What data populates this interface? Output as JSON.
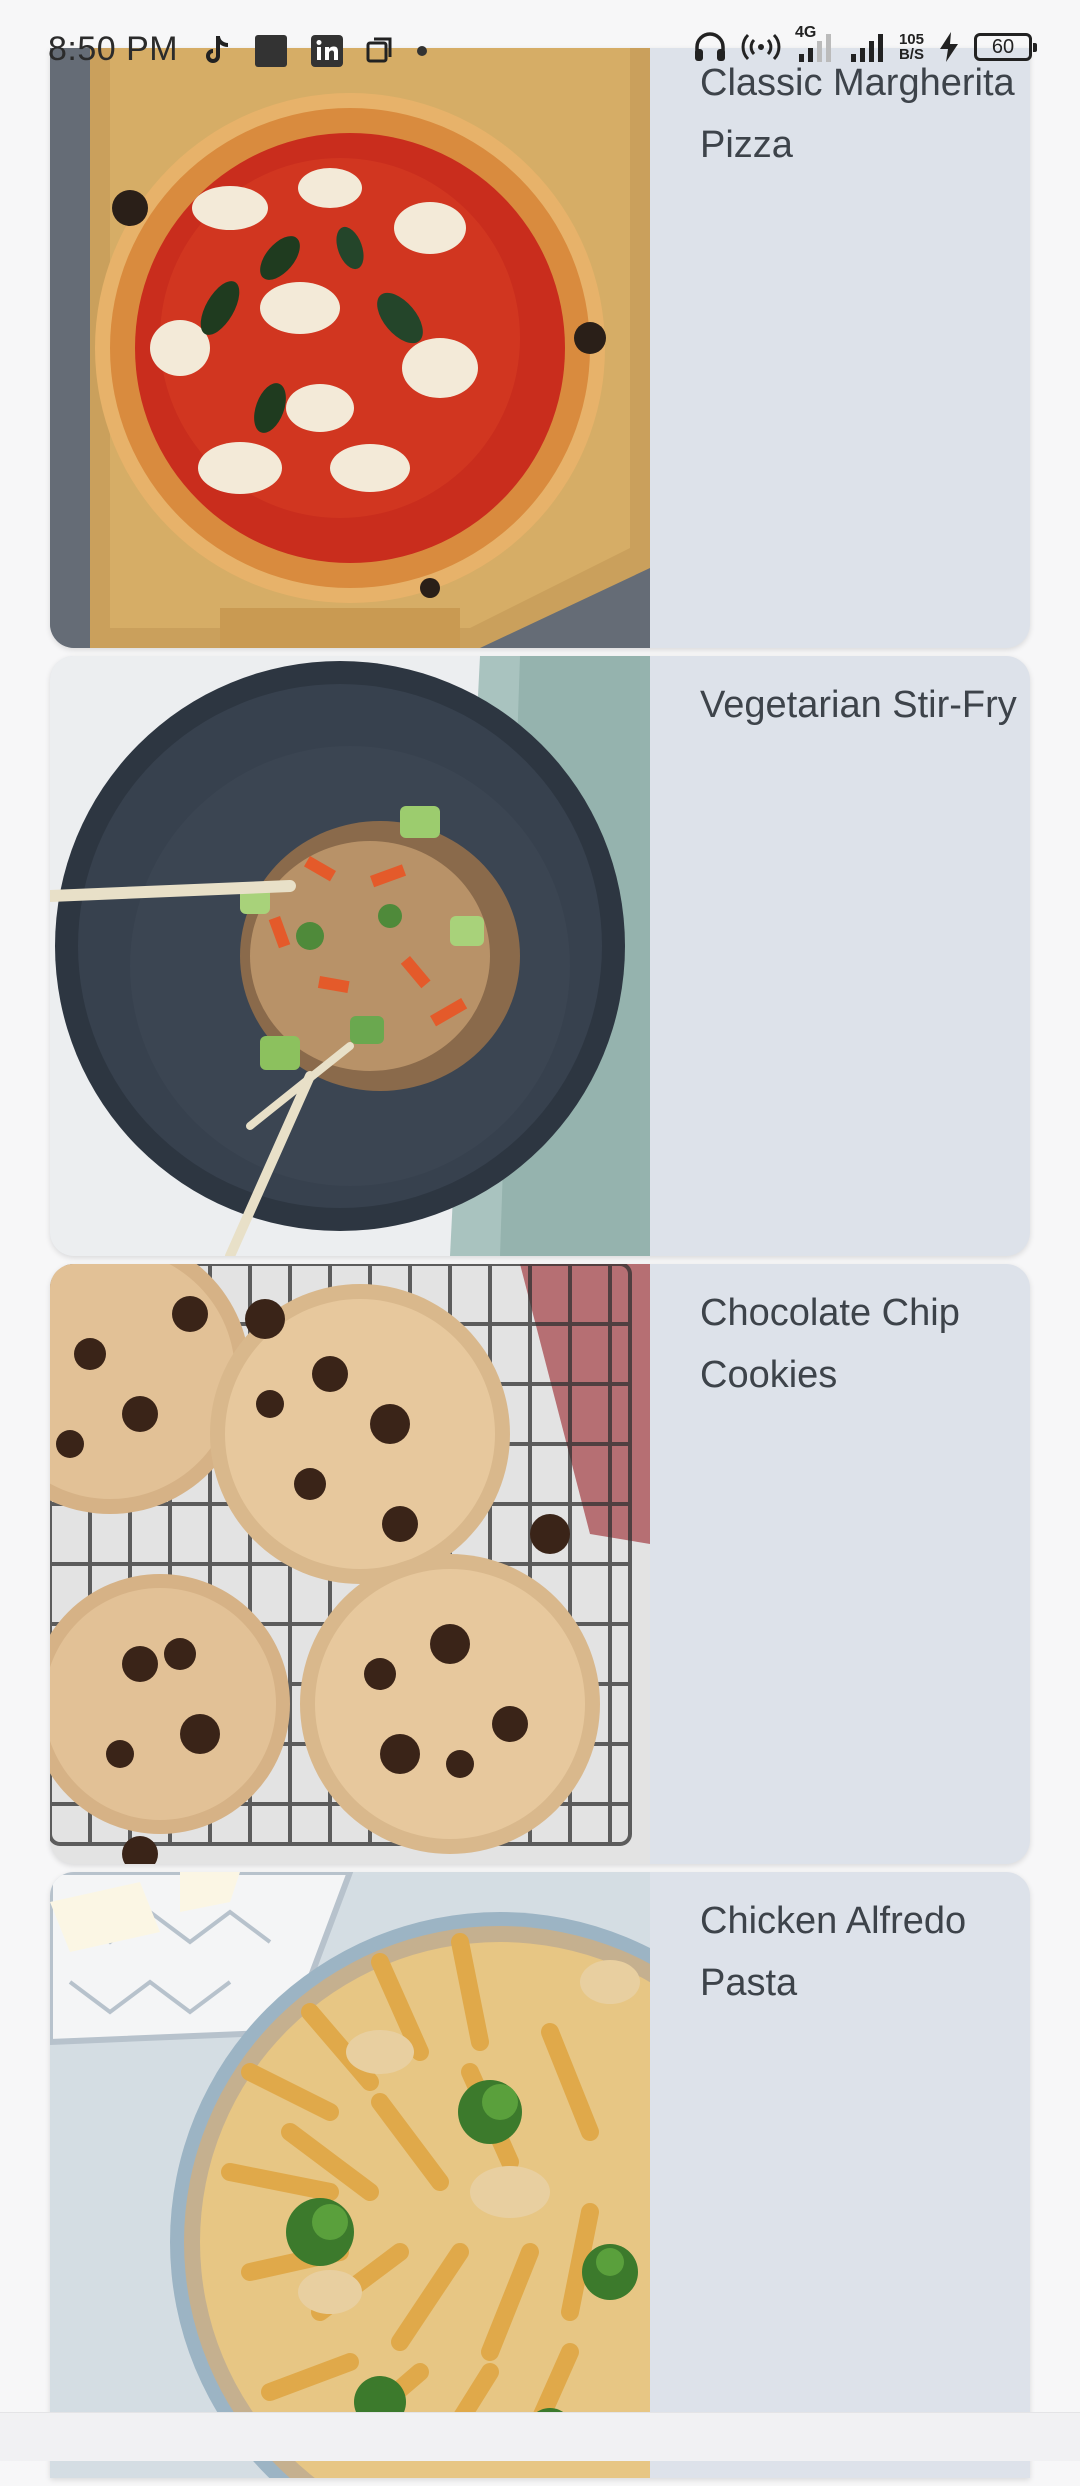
{
  "status_bar": {
    "time": "8:50 PM",
    "network_type": "4G",
    "net_speed_value": "105",
    "net_speed_unit": "B/S",
    "battery_level": "60",
    "left_icons": [
      "tiktok-icon",
      "app-square-icon",
      "linkedin-icon",
      "media-icon",
      "dot-icon"
    ],
    "right_icons": [
      "headphones-icon",
      "hotspot-icon",
      "signal-icon",
      "signal-icon",
      "charging-icon",
      "battery-icon"
    ]
  },
  "recipes": [
    {
      "title": "Classic Margherita Pizza",
      "image": "margherita-pizza-photo"
    },
    {
      "title": "Vegetarian Stir-Fry",
      "image": "vegetarian-stir-fry-photo"
    },
    {
      "title": "Chocolate Chip Cookies",
      "image": "chocolate-chip-cookies-photo"
    },
    {
      "title": "Chicken Alfredo Pasta",
      "image": "chicken-alfredo-pasta-photo"
    }
  ],
  "colors": {
    "card_background": "#dde2ea",
    "page_background": "#f7f7f8",
    "title_text": "#3d434a"
  }
}
